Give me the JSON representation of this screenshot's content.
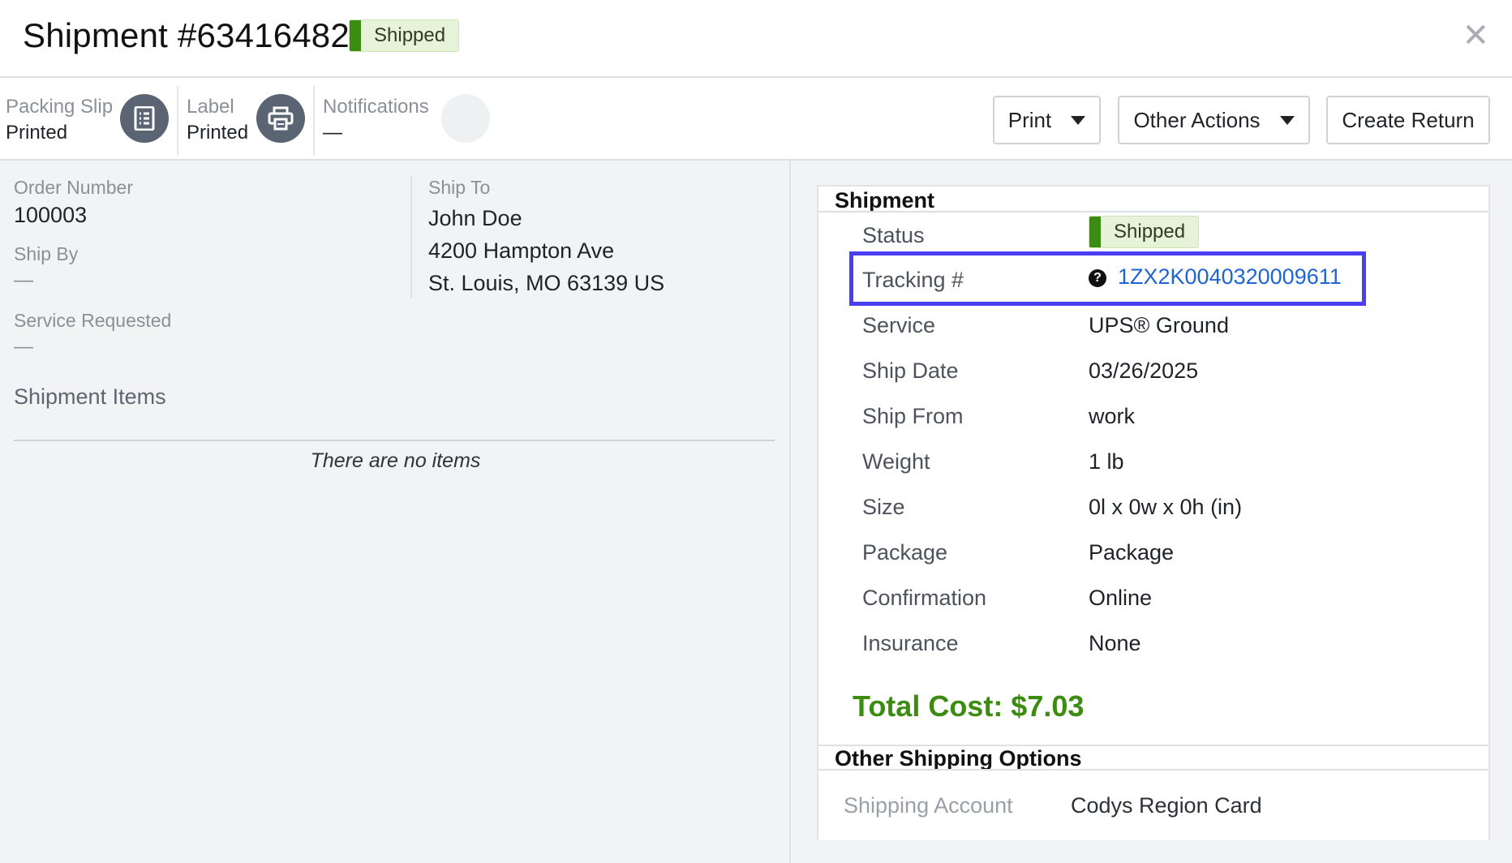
{
  "header": {
    "title": "Shipment #63416482",
    "status_badge": "Shipped",
    "close_icon": "close-icon"
  },
  "toolbar": {
    "packing_slip": {
      "label": "Packing Slip",
      "value": "Printed",
      "icon": "document-list-icon"
    },
    "label": {
      "label": "Label",
      "value": "Printed",
      "icon": "printer-icon"
    },
    "notifications": {
      "label": "Notifications",
      "value": "—"
    },
    "print_button": "Print",
    "other_actions_button": "Other Actions",
    "create_return_button": "Create Return"
  },
  "order": {
    "order_number_label": "Order Number",
    "order_number": "100003",
    "ship_by_label": "Ship By",
    "ship_by": "—",
    "service_requested_label": "Service Requested",
    "service_requested": "—",
    "ship_to_label": "Ship To",
    "ship_to": [
      "John Doe",
      "4200 Hampton Ave",
      "St. Louis, MO 63139 US"
    ],
    "items_heading": "Shipment Items",
    "items_empty": "There are no items"
  },
  "shipment": {
    "heading": "Shipment",
    "status_label": "Status",
    "status": "Shipped",
    "tracking_label": "Tracking #",
    "tracking": "1ZX2K0040320009611",
    "rows": [
      {
        "label": "Service",
        "value": "UPS® Ground"
      },
      {
        "label": "Ship Date",
        "value": "03/26/2025"
      },
      {
        "label": "Ship From",
        "value": "work"
      },
      {
        "label": "Weight",
        "value": "1 lb"
      },
      {
        "label": "Size",
        "value": "0l x 0w x 0h (in)"
      },
      {
        "label": "Package",
        "value": "Package"
      },
      {
        "label": "Confirmation",
        "value": "Online"
      },
      {
        "label": "Insurance",
        "value": "None"
      }
    ],
    "total_cost": "Total Cost: $7.03"
  },
  "other_options": {
    "heading": "Other Shipping Options",
    "account_label": "Shipping Account",
    "account_value": "Codys Region Card"
  },
  "colors": {
    "accent_green": "#3c8c12",
    "highlight_border": "#4a3ff0",
    "link_blue": "#1f64d4"
  }
}
